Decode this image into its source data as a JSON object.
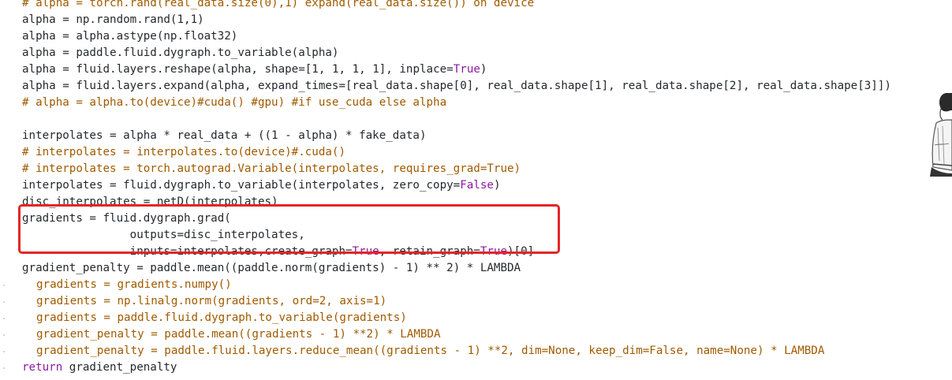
{
  "code": {
    "lines": [
      [
        {
          "t": "# alpha = torch.rand(real_data.size(0),1) expand(real_data.size()) on device",
          "c": "c"
        }
      ],
      [
        {
          "t": "alpha = np.random.rand(",
          "c": "n"
        },
        {
          "t": "1",
          "c": "num"
        },
        {
          "t": ",",
          "c": "n"
        },
        {
          "t": "1",
          "c": "num"
        },
        {
          "t": ")",
          "c": "n"
        }
      ],
      [
        {
          "t": "alpha = alpha.astype(np.float32)",
          "c": "n"
        }
      ],
      [
        {
          "t": "alpha = paddle.fluid.dygraph.to_variable(alpha)",
          "c": "n"
        }
      ],
      [
        {
          "t": "alpha = fluid.layers.reshape(alpha, shape=[",
          "c": "n"
        },
        {
          "t": "1",
          "c": "num"
        },
        {
          "t": ", ",
          "c": "n"
        },
        {
          "t": "1",
          "c": "num"
        },
        {
          "t": ", ",
          "c": "n"
        },
        {
          "t": "1",
          "c": "num"
        },
        {
          "t": ", ",
          "c": "n"
        },
        {
          "t": "1",
          "c": "num"
        },
        {
          "t": "], inplace=",
          "c": "n"
        },
        {
          "t": "True",
          "c": "const"
        },
        {
          "t": ")",
          "c": "n"
        }
      ],
      [
        {
          "t": "alpha = fluid.layers.expand(alpha, expand_times=[real_data.shape[",
          "c": "n"
        },
        {
          "t": "0",
          "c": "num"
        },
        {
          "t": "], real_data.shape[",
          "c": "n"
        },
        {
          "t": "1",
          "c": "num"
        },
        {
          "t": "], real_data.shape[",
          "c": "n"
        },
        {
          "t": "2",
          "c": "num"
        },
        {
          "t": "], real_data.shape[",
          "c": "n"
        },
        {
          "t": "3",
          "c": "num"
        },
        {
          "t": "]])",
          "c": "n"
        }
      ],
      [
        {
          "t": "# alpha = alpha.to(device)#cuda() #gpu) #if use_cuda else alpha",
          "c": "c"
        }
      ],
      [],
      [
        {
          "t": "interpolates = alpha * real_data + ((",
          "c": "n"
        },
        {
          "t": "1",
          "c": "num"
        },
        {
          "t": " - alpha) * fake_data)",
          "c": "n"
        }
      ],
      [
        {
          "t": "# interpolates = interpolates.to(device)#.cuda()",
          "c": "c"
        }
      ],
      [
        {
          "t": "# interpolates = torch.autograd.Variable(interpolates, requires_grad=True)",
          "c": "c"
        }
      ],
      [
        {
          "t": "interpolates = fluid.dygraph.to_variable(interpolates, zero_copy=",
          "c": "n"
        },
        {
          "t": "False",
          "c": "const"
        },
        {
          "t": ")",
          "c": "n"
        }
      ],
      [
        {
          "t": "disc_interpolates = netD(interpolates)",
          "c": "n"
        }
      ],
      [
        {
          "t": "gradients = fluid.dygraph.grad(",
          "c": "n"
        }
      ],
      [
        {
          "t": "                outputs=disc_interpolates,",
          "c": "n"
        }
      ],
      [
        {
          "t": "                inputs=interpolates,create_graph=",
          "c": "n"
        },
        {
          "t": "True",
          "c": "const"
        },
        {
          "t": ", retain_graph=",
          "c": "n"
        },
        {
          "t": "True",
          "c": "const"
        },
        {
          "t": ")[",
          "c": "n"
        },
        {
          "t": "0",
          "c": "num"
        },
        {
          "t": "]",
          "c": "n"
        }
      ],
      [
        {
          "t": "gradient_penalty = paddle.mean((paddle.norm(gradients) - ",
          "c": "n"
        },
        {
          "t": "1",
          "c": "num"
        },
        {
          "t": ") ** ",
          "c": "n"
        },
        {
          "t": "2",
          "c": "num"
        },
        {
          "t": ") * LAMBDA",
          "c": "n"
        }
      ],
      [
        {
          "t": "gradients = gradients.numpy()",
          "c": "c"
        }
      ],
      [
        {
          "t": "gradients = np.linalg.norm(gradients, ord=2, axis=1)",
          "c": "c"
        }
      ],
      [
        {
          "t": "gradients = paddle.fluid.dygraph.to_variable(gradients)",
          "c": "c"
        }
      ],
      [
        {
          "t": "gradient_penalty = paddle.mean((gradients - 1) **2) * LAMBDA",
          "c": "c"
        }
      ],
      [
        {
          "t": "gradient_penalty = paddle.fluid.layers.reduce_mean((gradients - 1) **2, dim=None, keep_dim=False, name=None) * LAMBDA",
          "c": "c"
        }
      ],
      [
        {
          "t": "return",
          "c": "kw"
        },
        {
          "t": " gradient_penalty",
          "c": "n"
        }
      ]
    ]
  },
  "colors": {
    "text": "#24292e",
    "comment": "#a05a00",
    "constant": "#8b1b9e",
    "highlight_box": "#e32626"
  },
  "decorations": {
    "highlight": "red-rectangle-highlight",
    "side_figure": "sketch-figure-image"
  }
}
